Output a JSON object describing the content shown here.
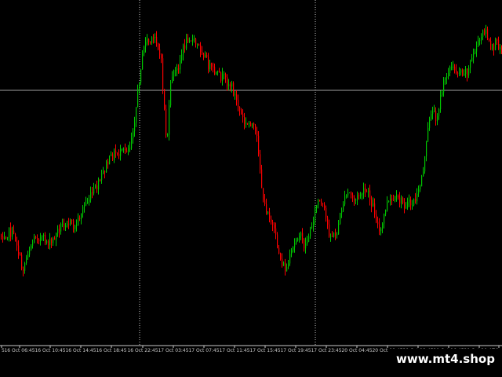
{
  "watermark": "www.mt4.shop",
  "colors": {
    "background": "#000000",
    "bull": "#00c800",
    "bear": "#ff0000",
    "axis": "#c8c8c8"
  },
  "chart_data": {
    "type": "candlestick",
    "grid": false,
    "ylim": [
      0,
      460
    ],
    "crosshair_y": 115,
    "session_separators": [
      178,
      402
    ],
    "tick_labels": [
      {
        "x": 2,
        "text": "5"
      },
      {
        "x": 25,
        "text": "16 Oct 06:45"
      },
      {
        "x": 64,
        "text": "16 Oct 10:45"
      },
      {
        "x": 103,
        "text": "16 Oct 14:45"
      },
      {
        "x": 142,
        "text": "16 Oct 18:45"
      },
      {
        "x": 182,
        "text": "16 Oct 22:45"
      },
      {
        "x": 221,
        "text": "17 Oct 03:45"
      },
      {
        "x": 260,
        "text": "17 Oct 07:45"
      },
      {
        "x": 299,
        "text": "17 Oct 11:45"
      },
      {
        "x": 338,
        "text": "17 Oct 15:45"
      },
      {
        "x": 377,
        "text": "17 Oct 19:45"
      },
      {
        "x": 416,
        "text": "17 Oct 23:45"
      },
      {
        "x": 455,
        "text": "20 Oct 04:45"
      },
      {
        "x": 494,
        "text": "20 Oct 08:45"
      },
      {
        "x": 533,
        "text": "20 Oct 12:45"
      },
      {
        "x": 572,
        "text": "20 Oct 16:45"
      },
      {
        "x": 611,
        "text": "20 Oct 20:45"
      },
      {
        "x": 636,
        "text": "21"
      }
    ],
    "path": [
      [
        0,
        300
      ],
      [
        12,
        295
      ],
      [
        20,
        305
      ],
      [
        28,
        345
      ],
      [
        35,
        320
      ],
      [
        45,
        300
      ],
      [
        55,
        305
      ],
      [
        65,
        310
      ],
      [
        75,
        290
      ],
      [
        85,
        280
      ],
      [
        95,
        290
      ],
      [
        105,
        265
      ],
      [
        115,
        250
      ],
      [
        125,
        235
      ],
      [
        135,
        210
      ],
      [
        145,
        195
      ],
      [
        155,
        195
      ],
      [
        165,
        185
      ],
      [
        172,
        145
      ],
      [
        178,
        90
      ],
      [
        185,
        50
      ],
      [
        192,
        55
      ],
      [
        198,
        45
      ],
      [
        205,
        80
      ],
      [
        212,
        185
      ],
      [
        218,
        95
      ],
      [
        225,
        90
      ],
      [
        232,
        65
      ],
      [
        240,
        45
      ],
      [
        248,
        55
      ],
      [
        258,
        65
      ],
      [
        266,
        85
      ],
      [
        275,
        95
      ],
      [
        285,
        100
      ],
      [
        295,
        110
      ],
      [
        303,
        135
      ],
      [
        312,
        160
      ],
      [
        320,
        155
      ],
      [
        328,
        180
      ],
      [
        335,
        260
      ],
      [
        342,
        270
      ],
      [
        350,
        300
      ],
      [
        357,
        330
      ],
      [
        364,
        345
      ],
      [
        372,
        320
      ],
      [
        380,
        295
      ],
      [
        388,
        315
      ],
      [
        396,
        290
      ],
      [
        404,
        255
      ],
      [
        412,
        265
      ],
      [
        420,
        300
      ],
      [
        428,
        300
      ],
      [
        436,
        260
      ],
      [
        444,
        245
      ],
      [
        452,
        255
      ],
      [
        460,
        245
      ],
      [
        468,
        245
      ],
      [
        476,
        265
      ],
      [
        484,
        300
      ],
      [
        492,
        260
      ],
      [
        500,
        255
      ],
      [
        508,
        255
      ],
      [
        516,
        260
      ],
      [
        524,
        260
      ],
      [
        532,
        250
      ],
      [
        540,
        210
      ],
      [
        548,
        140
      ],
      [
        556,
        150
      ],
      [
        564,
        110
      ],
      [
        572,
        85
      ],
      [
        580,
        90
      ],
      [
        588,
        90
      ],
      [
        596,
        90
      ],
      [
        604,
        65
      ],
      [
        612,
        50
      ],
      [
        618,
        35
      ],
      [
        625,
        65
      ],
      [
        632,
        55
      ],
      [
        640,
        60
      ]
    ]
  }
}
